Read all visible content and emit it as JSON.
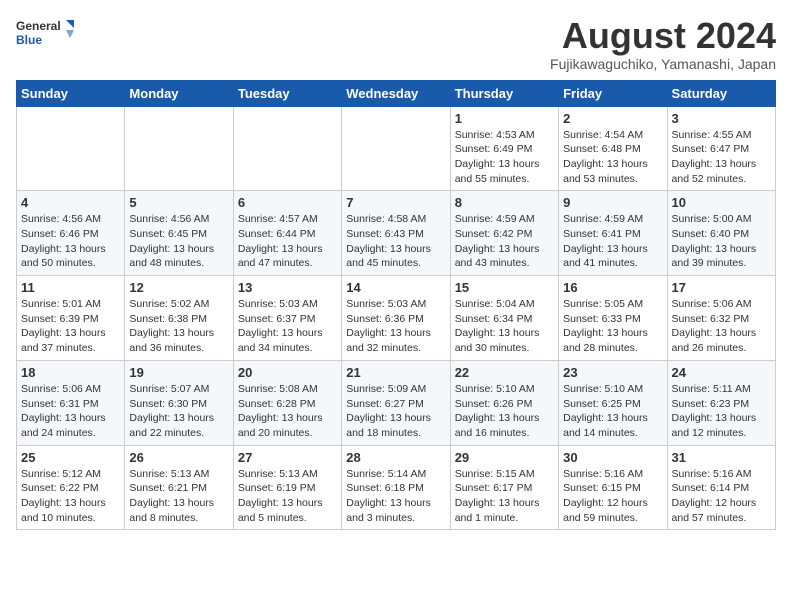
{
  "logo": {
    "line1": "General",
    "line2": "Blue"
  },
  "title": "August 2024",
  "location": "Fujikawaguchiko, Yamanashi, Japan",
  "headers": [
    "Sunday",
    "Monday",
    "Tuesday",
    "Wednesday",
    "Thursday",
    "Friday",
    "Saturday"
  ],
  "weeks": [
    [
      {
        "day": "",
        "info": ""
      },
      {
        "day": "",
        "info": ""
      },
      {
        "day": "",
        "info": ""
      },
      {
        "day": "",
        "info": ""
      },
      {
        "day": "1",
        "info": "Sunrise: 4:53 AM\nSunset: 6:49 PM\nDaylight: 13 hours\nand 55 minutes."
      },
      {
        "day": "2",
        "info": "Sunrise: 4:54 AM\nSunset: 6:48 PM\nDaylight: 13 hours\nand 53 minutes."
      },
      {
        "day": "3",
        "info": "Sunrise: 4:55 AM\nSunset: 6:47 PM\nDaylight: 13 hours\nand 52 minutes."
      }
    ],
    [
      {
        "day": "4",
        "info": "Sunrise: 4:56 AM\nSunset: 6:46 PM\nDaylight: 13 hours\nand 50 minutes."
      },
      {
        "day": "5",
        "info": "Sunrise: 4:56 AM\nSunset: 6:45 PM\nDaylight: 13 hours\nand 48 minutes."
      },
      {
        "day": "6",
        "info": "Sunrise: 4:57 AM\nSunset: 6:44 PM\nDaylight: 13 hours\nand 47 minutes."
      },
      {
        "day": "7",
        "info": "Sunrise: 4:58 AM\nSunset: 6:43 PM\nDaylight: 13 hours\nand 45 minutes."
      },
      {
        "day": "8",
        "info": "Sunrise: 4:59 AM\nSunset: 6:42 PM\nDaylight: 13 hours\nand 43 minutes."
      },
      {
        "day": "9",
        "info": "Sunrise: 4:59 AM\nSunset: 6:41 PM\nDaylight: 13 hours\nand 41 minutes."
      },
      {
        "day": "10",
        "info": "Sunrise: 5:00 AM\nSunset: 6:40 PM\nDaylight: 13 hours\nand 39 minutes."
      }
    ],
    [
      {
        "day": "11",
        "info": "Sunrise: 5:01 AM\nSunset: 6:39 PM\nDaylight: 13 hours\nand 37 minutes."
      },
      {
        "day": "12",
        "info": "Sunrise: 5:02 AM\nSunset: 6:38 PM\nDaylight: 13 hours\nand 36 minutes."
      },
      {
        "day": "13",
        "info": "Sunrise: 5:03 AM\nSunset: 6:37 PM\nDaylight: 13 hours\nand 34 minutes."
      },
      {
        "day": "14",
        "info": "Sunrise: 5:03 AM\nSunset: 6:36 PM\nDaylight: 13 hours\nand 32 minutes."
      },
      {
        "day": "15",
        "info": "Sunrise: 5:04 AM\nSunset: 6:34 PM\nDaylight: 13 hours\nand 30 minutes."
      },
      {
        "day": "16",
        "info": "Sunrise: 5:05 AM\nSunset: 6:33 PM\nDaylight: 13 hours\nand 28 minutes."
      },
      {
        "day": "17",
        "info": "Sunrise: 5:06 AM\nSunset: 6:32 PM\nDaylight: 13 hours\nand 26 minutes."
      }
    ],
    [
      {
        "day": "18",
        "info": "Sunrise: 5:06 AM\nSunset: 6:31 PM\nDaylight: 13 hours\nand 24 minutes."
      },
      {
        "day": "19",
        "info": "Sunrise: 5:07 AM\nSunset: 6:30 PM\nDaylight: 13 hours\nand 22 minutes."
      },
      {
        "day": "20",
        "info": "Sunrise: 5:08 AM\nSunset: 6:28 PM\nDaylight: 13 hours\nand 20 minutes."
      },
      {
        "day": "21",
        "info": "Sunrise: 5:09 AM\nSunset: 6:27 PM\nDaylight: 13 hours\nand 18 minutes."
      },
      {
        "day": "22",
        "info": "Sunrise: 5:10 AM\nSunset: 6:26 PM\nDaylight: 13 hours\nand 16 minutes."
      },
      {
        "day": "23",
        "info": "Sunrise: 5:10 AM\nSunset: 6:25 PM\nDaylight: 13 hours\nand 14 minutes."
      },
      {
        "day": "24",
        "info": "Sunrise: 5:11 AM\nSunset: 6:23 PM\nDaylight: 13 hours\nand 12 minutes."
      }
    ],
    [
      {
        "day": "25",
        "info": "Sunrise: 5:12 AM\nSunset: 6:22 PM\nDaylight: 13 hours\nand 10 minutes."
      },
      {
        "day": "26",
        "info": "Sunrise: 5:13 AM\nSunset: 6:21 PM\nDaylight: 13 hours\nand 8 minutes."
      },
      {
        "day": "27",
        "info": "Sunrise: 5:13 AM\nSunset: 6:19 PM\nDaylight: 13 hours\nand 5 minutes."
      },
      {
        "day": "28",
        "info": "Sunrise: 5:14 AM\nSunset: 6:18 PM\nDaylight: 13 hours\nand 3 minutes."
      },
      {
        "day": "29",
        "info": "Sunrise: 5:15 AM\nSunset: 6:17 PM\nDaylight: 13 hours\nand 1 minute."
      },
      {
        "day": "30",
        "info": "Sunrise: 5:16 AM\nSunset: 6:15 PM\nDaylight: 12 hours\nand 59 minutes."
      },
      {
        "day": "31",
        "info": "Sunrise: 5:16 AM\nSunset: 6:14 PM\nDaylight: 12 hours\nand 57 minutes."
      }
    ]
  ]
}
